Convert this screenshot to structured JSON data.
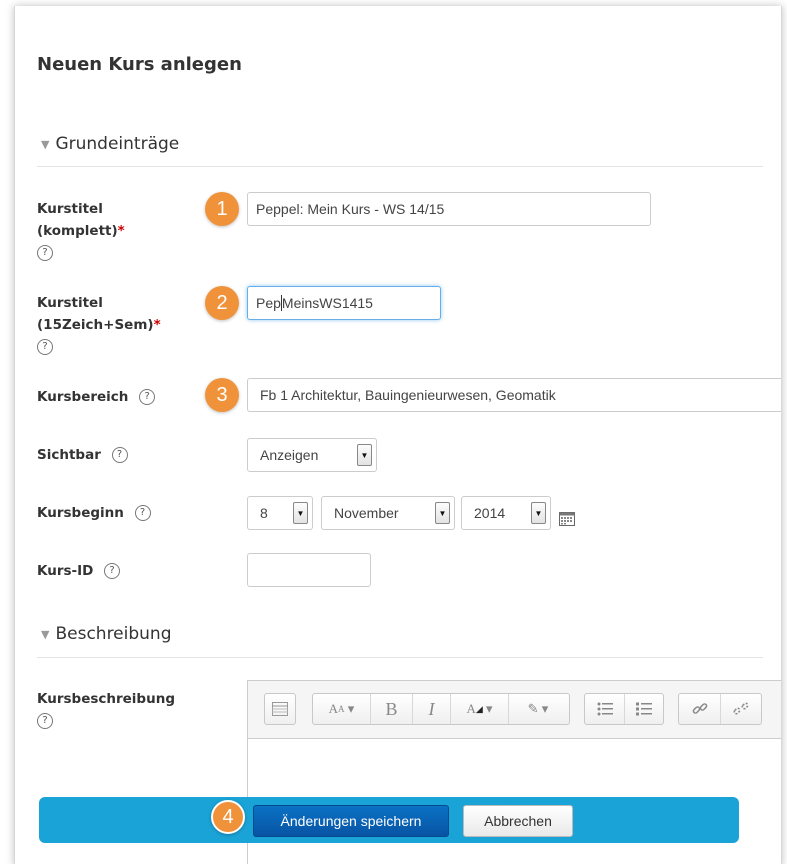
{
  "page": {
    "title": "Neuen Kurs anlegen"
  },
  "sections": {
    "general": "Grundeinträge",
    "description": "Beschreibung"
  },
  "fields": {
    "fullname": {
      "label_1": "Kurstitel",
      "label_2": "(komplett)",
      "required": "*",
      "value": "Peppel: Mein Kurs - WS 14/15",
      "badge": "1"
    },
    "shortname": {
      "label_1": "Kurstitel",
      "label_2": "(15Zeich+Sem)",
      "required": "*",
      "value_before_caret": "Pep",
      "value_after_caret": "MeinsWS1415",
      "badge": "2"
    },
    "category": {
      "label": "Kursbereich",
      "value": "Fb 1 Architektur, Bauingenieurwesen, Geomatik",
      "badge": "3"
    },
    "visible": {
      "label": "Sichtbar",
      "value": "Anzeigen"
    },
    "startdate": {
      "label": "Kursbeginn",
      "day": "8",
      "month": "November",
      "year": "2014"
    },
    "idnumber": {
      "label": "Kurs-ID",
      "value": ""
    },
    "summary": {
      "label": "Kursbeschreibung"
    }
  },
  "help_glyph": "?",
  "toolbar": {
    "bold": "B",
    "italic": "I",
    "icons": [
      "toolbar-toggle-icon",
      "text-style-icon",
      "bold-icon",
      "italic-icon",
      "font-color-icon",
      "highlight-icon",
      "unordered-list-icon",
      "ordered-list-icon",
      "link-icon",
      "unlink-icon"
    ]
  },
  "actions": {
    "badge": "4",
    "save": "Änderungen speichern",
    "cancel": "Abbrechen"
  },
  "colors": {
    "badge": "#f0923a",
    "save_bar": "#1aa3d6",
    "primary_button": "#0854a4",
    "required": "#cc0000"
  }
}
